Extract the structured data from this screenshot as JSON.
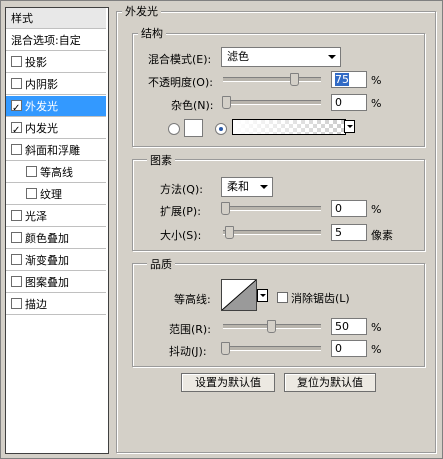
{
  "sidebar": {
    "header": "样式",
    "blend_options": "混合选项:自定",
    "items": [
      {
        "label": "投影",
        "checked": false
      },
      {
        "label": "内阴影",
        "checked": false
      },
      {
        "label": "外发光",
        "checked": true
      },
      {
        "label": "内发光",
        "checked": true
      },
      {
        "label": "斜面和浮雕",
        "checked": false
      },
      {
        "label": "等高线",
        "checked": false
      },
      {
        "label": "纹理",
        "checked": false
      },
      {
        "label": "光泽",
        "checked": false
      },
      {
        "label": "颜色叠加",
        "checked": false
      },
      {
        "label": "渐变叠加",
        "checked": false
      },
      {
        "label": "图案叠加",
        "checked": false
      },
      {
        "label": "描边",
        "checked": false
      }
    ]
  },
  "panel": {
    "title": "外发光",
    "structure": {
      "title": "结构",
      "blend_mode_label": "混合模式(E):",
      "blend_mode_value": "滤色",
      "opacity_label": "不透明度(O):",
      "opacity_value": "75",
      "opacity_unit": "%",
      "opacity_level": 0.75,
      "noise_label": "杂色(N):",
      "noise_value": "0",
      "noise_unit": "%",
      "noise_level": 0
    },
    "elements": {
      "title": "图素",
      "method_label": "方法(Q):",
      "method_value": "柔和",
      "spread_label": "扩展(P):",
      "spread_value": "0",
      "spread_unit": "%",
      "size_label": "大小(S):",
      "size_value": "5",
      "size_unit": "像素"
    },
    "quality": {
      "title": "品质",
      "contour_label": "等高线:",
      "antialias_label": "消除锯齿(L)",
      "range_label": "范围(R):",
      "range_value": "50",
      "range_unit": "%",
      "range_level": 0.5,
      "jitter_label": "抖动(J):",
      "jitter_value": "0",
      "jitter_unit": "%"
    },
    "buttons": {
      "set_default": "设置为默认值",
      "reset_default": "复位为默认值"
    }
  }
}
